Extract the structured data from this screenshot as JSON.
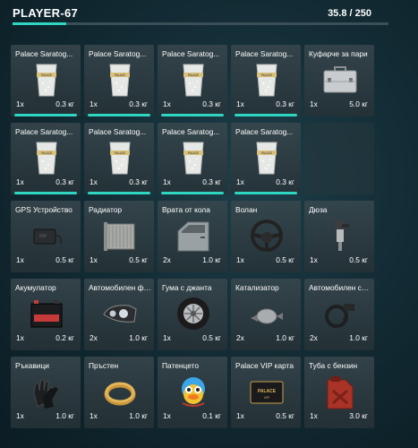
{
  "header": {
    "player": "PLAYER-67",
    "weight": "35.8 / 250",
    "weight_fraction": 0.143
  },
  "items": [
    {
      "name": "Palace Saratog...",
      "qty": "1x",
      "weight": "0.3 кг",
      "icon": "drink-cup-icon",
      "durability": true
    },
    {
      "name": "Palace Saratog...",
      "qty": "1x",
      "weight": "0.3 кг",
      "icon": "drink-cup-icon",
      "durability": true
    },
    {
      "name": "Palace Saratog...",
      "qty": "1x",
      "weight": "0.3 кг",
      "icon": "drink-cup-icon",
      "durability": true
    },
    {
      "name": "Palace Saratog...",
      "qty": "1x",
      "weight": "0.3 кг",
      "icon": "drink-cup-icon",
      "durability": true
    },
    {
      "name": "Куфарче за пари",
      "qty": "1x",
      "weight": "5.0 кг",
      "icon": "money-case-icon",
      "durability": false
    },
    {
      "name": "Palace Saratog...",
      "qty": "1x",
      "weight": "0.3 кг",
      "icon": "drink-cup-icon",
      "durability": true
    },
    {
      "name": "Palace Saratog...",
      "qty": "1x",
      "weight": "0.3 кг",
      "icon": "drink-cup-icon",
      "durability": true
    },
    {
      "name": "Palace Saratog...",
      "qty": "1x",
      "weight": "0.3 кг",
      "icon": "drink-cup-icon",
      "durability": true
    },
    {
      "name": "Palace Saratog...",
      "qty": "1x",
      "weight": "0.3 кг",
      "icon": "drink-cup-icon",
      "durability": true
    },
    {
      "empty": true
    },
    {
      "name": "GPS Устройство",
      "qty": "1x",
      "weight": "0.5 кг",
      "icon": "gps-device-icon",
      "durability": false
    },
    {
      "name": "Радиатор",
      "qty": "1x",
      "weight": "0.5 кг",
      "icon": "radiator-icon",
      "durability": false
    },
    {
      "name": "Врата от кола",
      "qty": "2x",
      "weight": "1.0 кг",
      "icon": "car-door-icon",
      "durability": false
    },
    {
      "name": "Волан",
      "qty": "1x",
      "weight": "0.5 кг",
      "icon": "steering-wheel-icon",
      "durability": false
    },
    {
      "name": "Дюза",
      "qty": "1x",
      "weight": "0.5 кг",
      "icon": "injector-icon",
      "durability": false
    },
    {
      "name": "Акумулатор",
      "qty": "1x",
      "weight": "0.2 кг",
      "icon": "battery-icon",
      "durability": false
    },
    {
      "name": "Автомобилен фар",
      "qty": "2x",
      "weight": "1.0 кг",
      "icon": "headlight-icon",
      "durability": false
    },
    {
      "name": "Гума с джанта",
      "qty": "1x",
      "weight": "0.5 кг",
      "icon": "tire-icon",
      "durability": false
    },
    {
      "name": "Катализатор",
      "qty": "2x",
      "weight": "1.0 кг",
      "icon": "catalytic-converter-icon",
      "durability": false
    },
    {
      "name": "Автомобилен се...",
      "qty": "2x",
      "weight": "1.0 кг",
      "icon": "car-sensor-icon",
      "durability": false
    },
    {
      "name": "Ръкавици",
      "qty": "1x",
      "weight": "1.0 кг",
      "icon": "gloves-icon",
      "durability": false
    },
    {
      "name": "Пръстен",
      "qty": "1x",
      "weight": "1.0 кг",
      "icon": "ring-icon",
      "durability": false
    },
    {
      "name": "Патенцето",
      "qty": "1x",
      "weight": "0.1 кг",
      "icon": "duck-icon",
      "durability": false
    },
    {
      "name": "Palace VIP карта",
      "qty": "1x",
      "weight": "0.5 кг",
      "icon": "vip-card-icon",
      "durability": false,
      "icon_text": "PALACE VIP"
    },
    {
      "name": "Туба с бензин",
      "qty": "1x",
      "weight": "3.0 кг",
      "icon": "fuel-canister-icon",
      "durability": false
    }
  ]
}
